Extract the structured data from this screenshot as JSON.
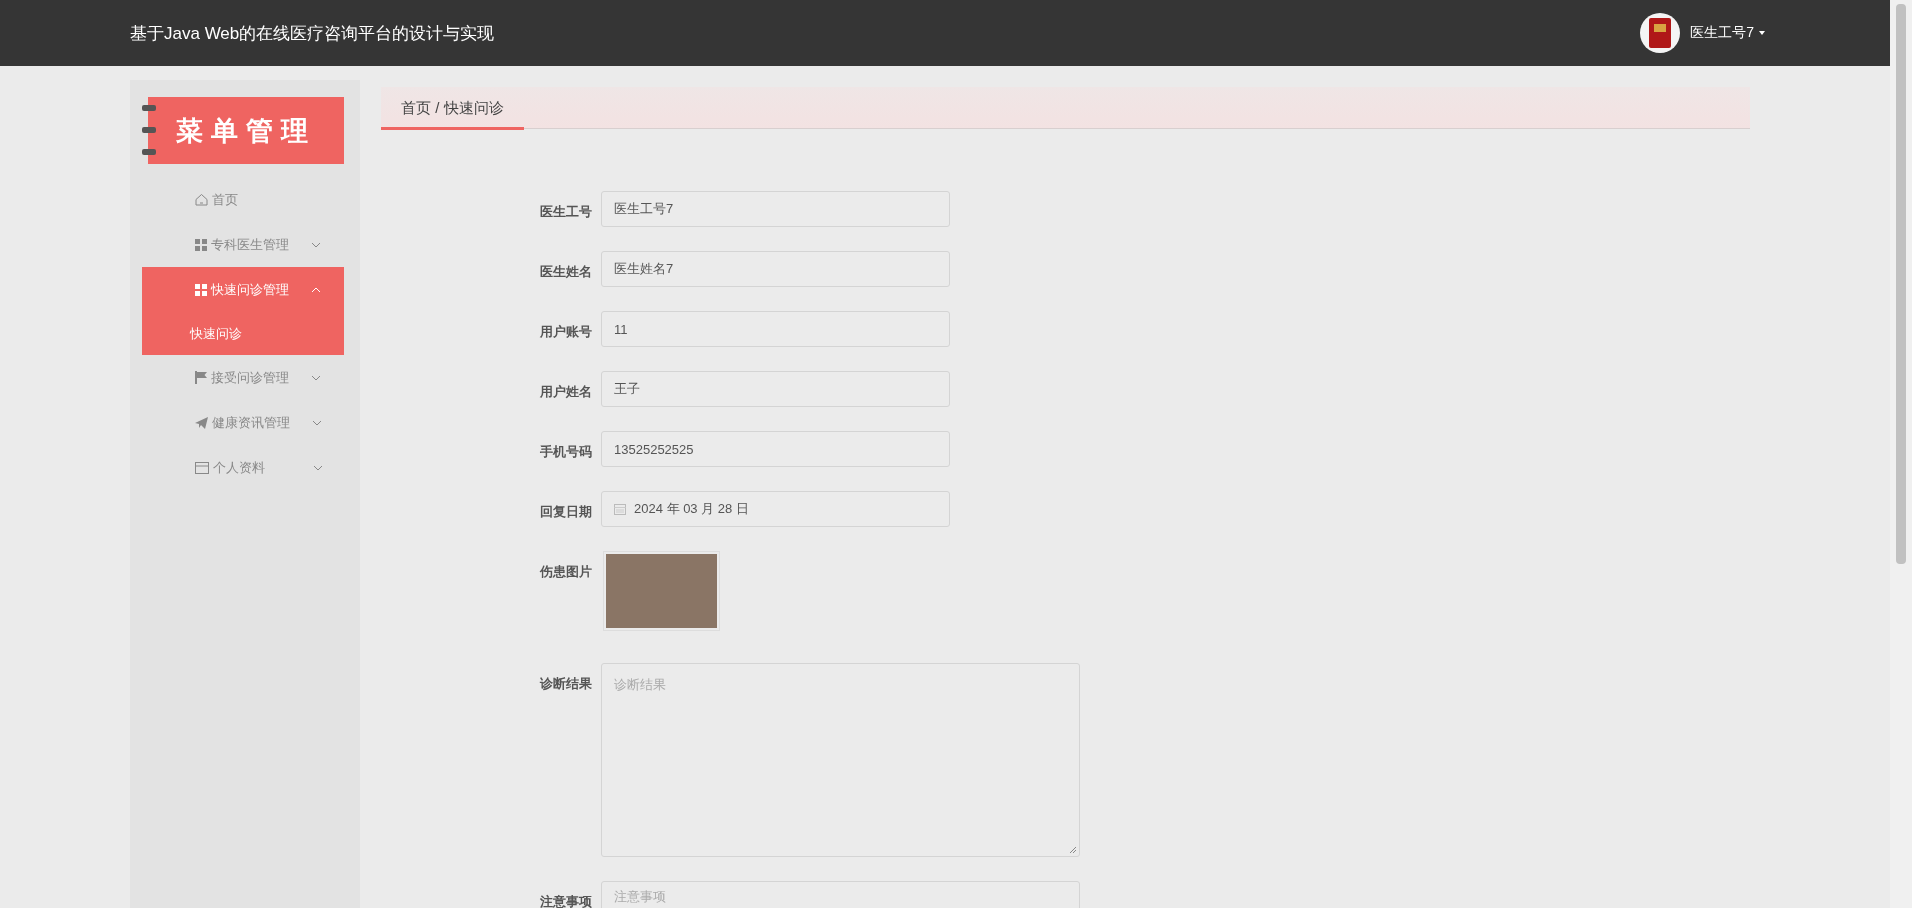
{
  "header": {
    "title": "基于Java Web的在线医疗咨询平台的设计与实现",
    "user": "医生工号7"
  },
  "sidebar": {
    "title": "菜单管理",
    "items": [
      {
        "label": "首页",
        "selected": false
      },
      {
        "label": "专科医生管理",
        "selected": false,
        "expanded": false
      },
      {
        "label": "快速问诊管理",
        "selected": true,
        "expanded": true,
        "children": [
          {
            "label": "快速问诊",
            "selected": true
          }
        ]
      },
      {
        "label": "接受问诊管理",
        "selected": false,
        "expanded": false
      },
      {
        "label": "健康资讯管理",
        "selected": false,
        "expanded": false
      },
      {
        "label": "个人资料",
        "selected": false,
        "expanded": false
      }
    ]
  },
  "breadcrumb": "首页 / 快速问诊",
  "form": {
    "fields": [
      {
        "kind": "text",
        "label": "医生工号",
        "value": "医生工号7"
      },
      {
        "kind": "text",
        "label": "医生姓名",
        "value": "医生姓名7"
      },
      {
        "kind": "text",
        "label": "用户账号",
        "value": "11"
      },
      {
        "kind": "text",
        "label": "用户姓名",
        "value": "王子"
      },
      {
        "kind": "text",
        "label": "手机号码",
        "value": "13525252525"
      },
      {
        "kind": "date",
        "label": "回复日期",
        "value": "2024 年 03 月 28 日"
      },
      {
        "kind": "image",
        "label": "伤患图片"
      },
      {
        "kind": "textarea",
        "label": "诊断结果",
        "placeholder": "诊断结果"
      },
      {
        "kind": "textarea-cut",
        "label": "注意事项",
        "placeholder": "注意事项"
      }
    ]
  }
}
